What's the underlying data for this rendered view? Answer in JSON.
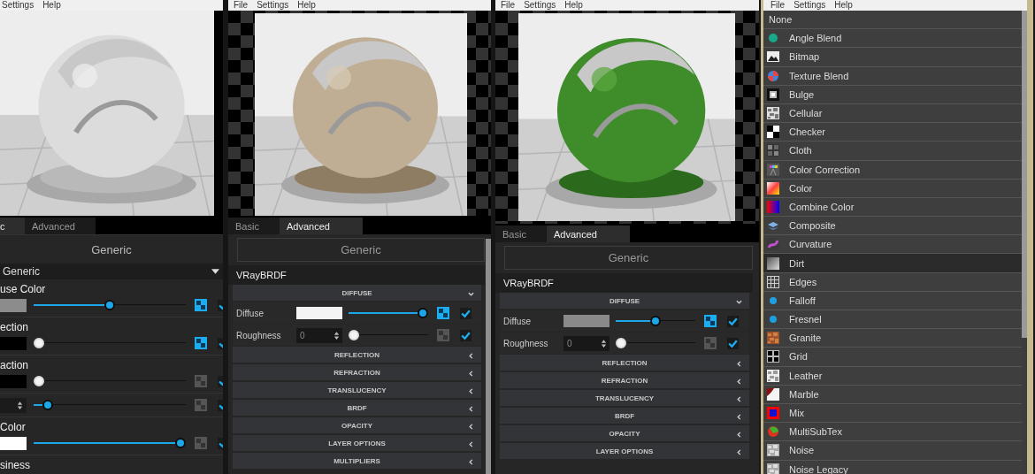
{
  "editors": [
    {
      "kind": "basic",
      "menu": [
        "Settings",
        "Help"
      ],
      "tabs": [
        {
          "label": "c",
          "selected": true
        },
        {
          "label": "Advanced",
          "selected": false
        }
      ],
      "header": "Generic",
      "type_dropdown": "Generic",
      "properties": [
        {
          "label": "use Color",
          "kind": "color",
          "color": "#8c8c8c",
          "level": 0.5,
          "map_active": true,
          "checked": true
        },
        {
          "label": "ection",
          "kind": "color",
          "color": "#000000",
          "level": 0,
          "map_active": true,
          "checked": true
        },
        {
          "label": "action",
          "kind": "color",
          "color": "#000000",
          "level": 0,
          "map_active": false,
          "checked": true
        },
        {
          "kind": "number",
          "level": 0.06,
          "map_active": false,
          "checked": true
        },
        {
          "label": "Color",
          "kind": "color",
          "color": "#ffffff",
          "level": 1,
          "map_active": false,
          "checked": true
        },
        {
          "label": "siness",
          "kind": "label"
        }
      ]
    },
    {
      "kind": "advanced",
      "menu": [
        "File",
        "Settings",
        "Help"
      ],
      "tabs": [
        {
          "label": "Basic",
          "selected": false
        },
        {
          "label": "Advanced",
          "selected": true
        }
      ],
      "header": "Generic",
      "material_type": "VRayBRDF",
      "sections": [
        {
          "title": "DIFFUSE",
          "expanded": true,
          "params": [
            {
              "label": "Diffuse",
              "kind": "color",
              "color": "#f4f4f4",
              "level": 1,
              "map_active": true,
              "checked": true
            },
            {
              "label": "Roughness",
              "kind": "number",
              "value": "0",
              "level": 0,
              "map_active": false,
              "checked": true
            }
          ]
        },
        {
          "title": "REFLECTION",
          "expanded": false
        },
        {
          "title": "REFRACTION",
          "expanded": false
        },
        {
          "title": "TRANSLUCENCY",
          "expanded": false
        },
        {
          "title": "BRDF",
          "expanded": false
        },
        {
          "title": "OPACITY",
          "expanded": false
        },
        {
          "title": "LAYER OPTIONS",
          "expanded": false
        },
        {
          "title": "MULTIPLIERS",
          "expanded": false
        }
      ]
    },
    {
      "kind": "advanced",
      "menu": [
        "File",
        "Settings",
        "Help"
      ],
      "tabs": [
        {
          "label": "Basic",
          "selected": false
        },
        {
          "label": "Advanced",
          "selected": true
        }
      ],
      "header": "Generic",
      "material_type": "VRayBRDF",
      "sections": [
        {
          "title": "DIFFUSE",
          "expanded": true,
          "params": [
            {
              "label": "Diffuse",
              "kind": "color",
              "color": "#8a8a8a",
              "level": 0.5,
              "map_active": true,
              "checked": true
            },
            {
              "label": "Roughness",
              "kind": "number",
              "value": "0",
              "level": 0,
              "map_active": false,
              "checked": true
            }
          ]
        },
        {
          "title": "REFLECTION",
          "expanded": false
        },
        {
          "title": "REFRACTION",
          "expanded": false
        },
        {
          "title": "TRANSLUCENCY",
          "expanded": false
        },
        {
          "title": "BRDF",
          "expanded": false
        },
        {
          "title": "OPACITY",
          "expanded": false
        },
        {
          "title": "LAYER OPTIONS",
          "expanded": false
        }
      ]
    }
  ],
  "texture_list": {
    "menu": [
      "File",
      "Settings",
      "Help"
    ],
    "items": [
      {
        "label": "None",
        "selected": false
      },
      {
        "label": "Angle Blend",
        "selected": false
      },
      {
        "label": "Bitmap",
        "selected": false
      },
      {
        "label": "Texture Blend",
        "selected": false
      },
      {
        "label": "Bulge",
        "selected": false
      },
      {
        "label": "Cellular",
        "selected": false
      },
      {
        "label": "Checker",
        "selected": false
      },
      {
        "label": "Cloth",
        "selected": false
      },
      {
        "label": "Color Correction",
        "selected": false
      },
      {
        "label": "Color",
        "selected": false
      },
      {
        "label": "Combine Color",
        "selected": false
      },
      {
        "label": "Composite",
        "selected": false
      },
      {
        "label": "Curvature",
        "selected": false
      },
      {
        "label": "Dirt",
        "selected": true
      },
      {
        "label": "Edges",
        "selected": false
      },
      {
        "label": "Falloff",
        "selected": false
      },
      {
        "label": "Fresnel",
        "selected": false
      },
      {
        "label": "Granite",
        "selected": false
      },
      {
        "label": "Grid",
        "selected": false
      },
      {
        "label": "Leather",
        "selected": false
      },
      {
        "label": "Marble",
        "selected": false
      },
      {
        "label": "Mix",
        "selected": false
      },
      {
        "label": "MultiSubTex",
        "selected": false
      },
      {
        "label": "Noise",
        "selected": false
      },
      {
        "label": "Noise Legacy",
        "selected": false
      }
    ]
  }
}
